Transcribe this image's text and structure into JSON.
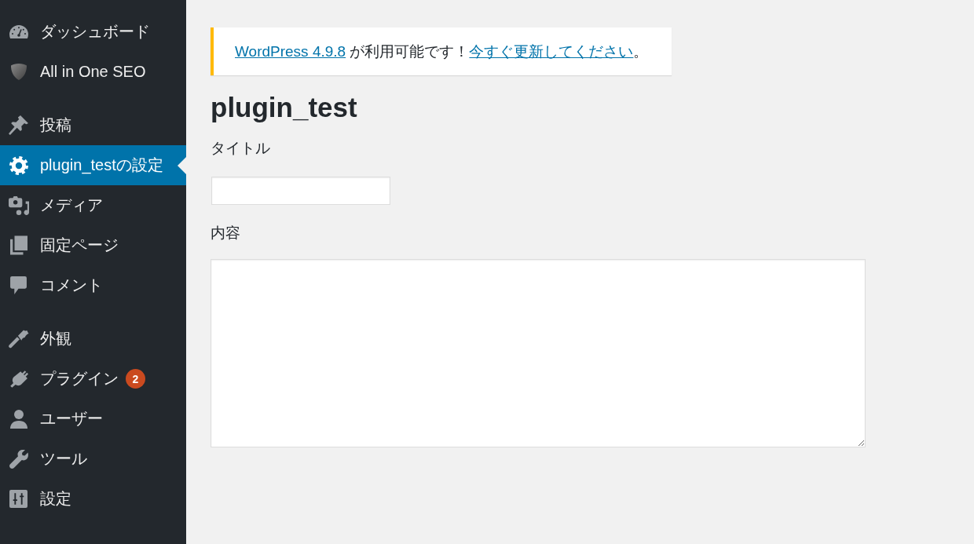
{
  "sidebar": {
    "groups": [
      {
        "items": [
          {
            "label": "ダッシュボード",
            "selected": false
          },
          {
            "label": "All in One SEO",
            "selected": false
          }
        ]
      },
      {
        "items": [
          {
            "label": "投稿",
            "selected": false
          },
          {
            "label": "plugin_testの設定",
            "selected": true
          },
          {
            "label": "メディア",
            "selected": false
          },
          {
            "label": "固定ページ",
            "selected": false
          },
          {
            "label": "コメント",
            "selected": false
          }
        ]
      },
      {
        "items": [
          {
            "label": "外観",
            "selected": false
          },
          {
            "label": "プラグイン",
            "selected": false,
            "badge": "2"
          },
          {
            "label": "ユーザー",
            "selected": false
          },
          {
            "label": "ツール",
            "selected": false
          },
          {
            "label": "設定",
            "selected": false
          }
        ]
      }
    ]
  },
  "notice": {
    "segments": [
      {
        "kind": "link",
        "text": "WordPress 4.9.8"
      },
      {
        "kind": "text",
        "text": " が利用可能です！"
      },
      {
        "kind": "link",
        "text": "今すぐ更新してください"
      },
      {
        "kind": "text",
        "text": "。"
      }
    ]
  },
  "page_title": "plugin_test",
  "form": {
    "fields": [
      {
        "label": "タイトル",
        "kind": "input"
      },
      {
        "label": "内容",
        "kind": "textarea"
      }
    ]
  }
}
